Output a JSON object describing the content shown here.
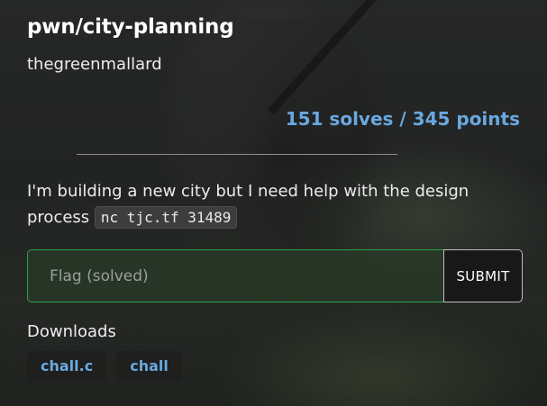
{
  "challenge": {
    "title": "pwn/city-planning",
    "author": "thegreenmallard",
    "stats": "151 solves / 345 points",
    "description": "I'm building a new city but I need help with the design process",
    "connection": "nc tjc.tf 31489"
  },
  "flag_form": {
    "placeholder": "Flag (solved)",
    "value": "",
    "submit_label": "SUBMIT"
  },
  "downloads": {
    "heading": "Downloads",
    "files": [
      {
        "label": "chall.c"
      },
      {
        "label": "chall"
      }
    ]
  },
  "colors": {
    "accent_blue": "#6aa8e0",
    "solved_green": "#2ea04a",
    "background": "#1e1f1f"
  }
}
